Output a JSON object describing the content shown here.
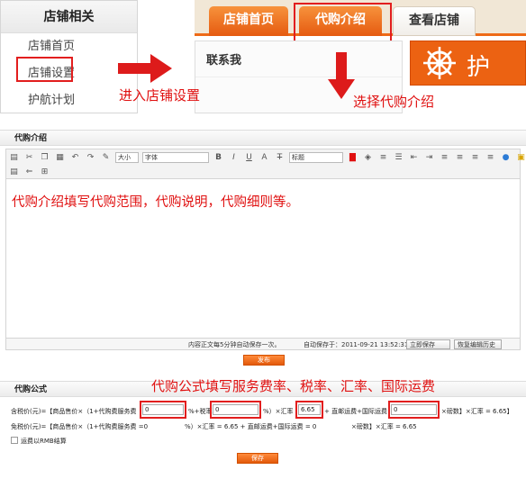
{
  "sidebar": {
    "title": "店铺相关",
    "items": [
      {
        "label": "店铺首页"
      },
      {
        "label": "店铺设置"
      },
      {
        "label": "护航计划"
      }
    ]
  },
  "tabs": [
    {
      "label": "店铺首页"
    },
    {
      "label": "代购介绍"
    },
    {
      "label": "查看店铺"
    }
  ],
  "contact": {
    "title": "联系我"
  },
  "banner": {
    "text": "护"
  },
  "annotations": {
    "enter_settings": "进入店铺设置",
    "select_intro": "选择代购介绍",
    "intro_hint": "代购介绍填写代购范围，代购说明，代购细则等。",
    "formula_hint": "代购公式填写服务费率、税率、汇率、国际运费"
  },
  "intro_section": {
    "title": "代购介绍"
  },
  "editor": {
    "size_select": "大小",
    "font_select": "字体",
    "heading_select": "标题",
    "autosave_note": "内容正文每5分钟自动保存一次。",
    "autosave_time": "自动保存于：2011-09-21 13:52:31",
    "save_now": "立即保存",
    "restore_history": "恢复编辑历史",
    "publish": "发布"
  },
  "formula_section": {
    "title": "代购公式",
    "tax_line": {
      "prefix": "含税价(元)=【商品售价×（1+代购费服务费",
      "service_value": "0",
      "mid1": "%+税率",
      "tax_value": "0",
      "mid2": "%）×汇率",
      "rate_value": "6.65",
      "mid3": "+ 直邮运费+国际运费",
      "shipping_value": "0",
      "suffix": "×磅数】×汇率 = 6.65】"
    },
    "free_line": {
      "prefix": "免税价(元)=【商品售价×（1+代购费服务费 =0",
      "mid": "%）×汇率 = 6.65 + 直邮运费+国际运费 = 0",
      "suffix": "×磅数】×汇率 = 6.65"
    },
    "checkbox_label": "运费以RMB结算",
    "save": "保存"
  },
  "colors": {
    "accent_orange": "#ee6a17",
    "annotation_red": "#e01010"
  }
}
